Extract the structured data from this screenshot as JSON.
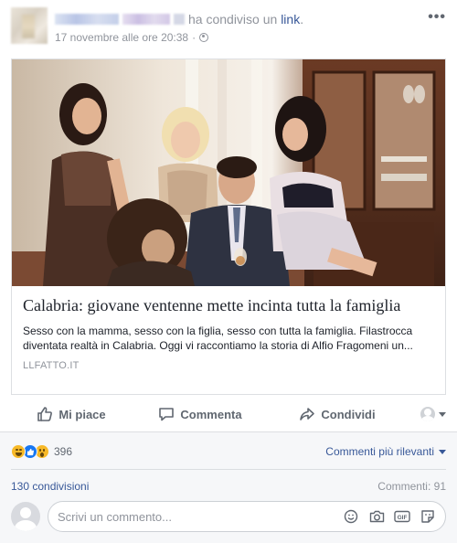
{
  "post": {
    "shared_text": "ha condiviso un",
    "link_word": "link",
    "trailing_dot": ".",
    "timestamp": "17 novembre alle ore 20:38",
    "separator": "·",
    "more_menu": "•••"
  },
  "link_card": {
    "title": "Calabria: giovane ventenne mette incinta tutta la famiglia",
    "description": "Sesso con la mamma, sesso con la figlia, sesso con tutta la famiglia. Filastrocca diventata realtà in Calabria. Oggi vi raccontiamo la storia di Alfio Fragomeni un...",
    "domain": "LLFATTO.IT"
  },
  "actions": {
    "like": "Mi piace",
    "comment": "Commenta",
    "share": "Condividi"
  },
  "engagement": {
    "reactions": [
      "haha",
      "like",
      "wow"
    ],
    "reaction_count": "396",
    "sort_label": "Commenti più rilevanti",
    "shares": "130 condivisioni",
    "comments": "Commenti: 91"
  },
  "composer": {
    "placeholder": "Scrivi un commento...",
    "icons": [
      "emoji-icon",
      "camera-icon",
      "gif-icon",
      "sticker-icon"
    ]
  },
  "colors": {
    "link_blue": "#385898",
    "muted": "#90949c",
    "action_gray": "#606770",
    "like_blue": "#1877f2",
    "haha_yellow": "#f7b928"
  }
}
